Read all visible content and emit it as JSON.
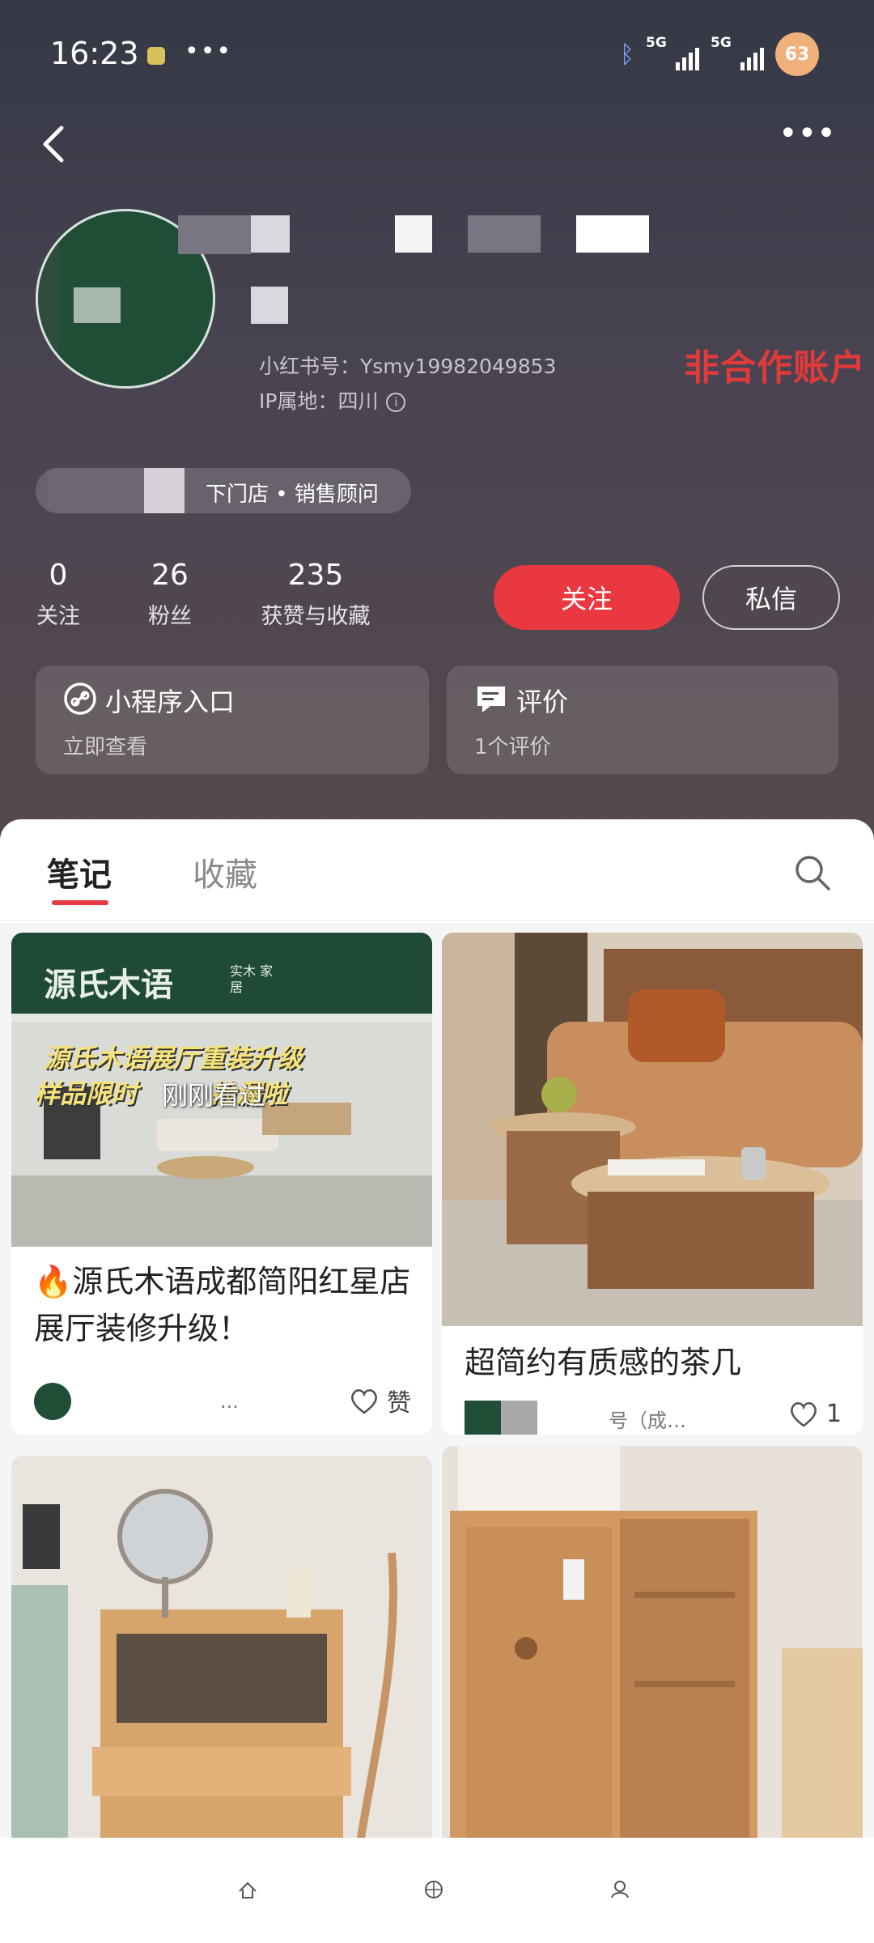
{
  "status_bar": {
    "time": "16:23",
    "more": "•••",
    "network_1": "5G",
    "network_2": "5G",
    "battery": "63",
    "bluetooth_icon": "bluetooth-icon"
  },
  "profile": {
    "red_id": "小红书号：Ysmy19982049853",
    "ip_location": "IP属地：四川",
    "info_icon": "i",
    "annotation": "非合作账户",
    "store_tag": "下门店 • 销售顾问",
    "stats": [
      {
        "value": "0",
        "label": "关注"
      },
      {
        "value": "26",
        "label": "粉丝"
      },
      {
        "value": "235",
        "label": "获赞与收藏"
      }
    ],
    "follow_label": "关注",
    "message_label": "私信"
  },
  "cards": [
    {
      "title": "小程序入口",
      "subtitle": "立即查看",
      "icon": "link-icon"
    },
    {
      "title": "评价",
      "subtitle": "1个评价",
      "icon": "chat-bubble-icon"
    }
  ],
  "tabs": {
    "items": [
      {
        "label": "笔记",
        "active": true
      },
      {
        "label": "收藏",
        "active": false
      }
    ]
  },
  "posts": [
    {
      "image_sign_text": "源氏木语",
      "image_sign_sub": "实木 家居",
      "image_banner_line1": "源氏木语展厅重装升级",
      "image_banner_line2": "样品限时        捡漏啦",
      "overlay": "刚刚看过",
      "title_emoji": "🔥",
      "title": "源氏木语成都简阳红星店展厅装修升级！",
      "author": "...",
      "likes": "赞"
    },
    {
      "title": "超简约有质感的茶几",
      "author": "号（成…",
      "likes": "1"
    },
    {
      "title": ""
    },
    {
      "title": ""
    }
  ],
  "colors": {
    "accent": "#e9383f",
    "annotation": "#e03a3a"
  }
}
